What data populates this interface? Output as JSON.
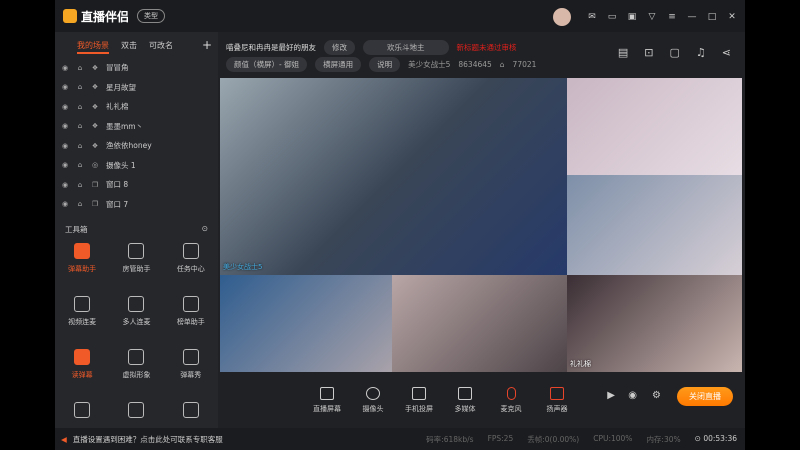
{
  "app": {
    "title": "直播伴侣",
    "type_btn": "类型"
  },
  "scenes": {
    "tabs": [
      "我的场景",
      "双击",
      "可改名"
    ],
    "sources": [
      {
        "type": "group",
        "name": "冒冒角"
      },
      {
        "type": "group",
        "name": "星月故望"
      },
      {
        "type": "group",
        "name": "礼礼棉"
      },
      {
        "type": "group",
        "name": "墨墨mm丶"
      },
      {
        "type": "group",
        "name": "渔依依honey"
      },
      {
        "type": "camera",
        "name": "摄像头 1"
      },
      {
        "type": "window",
        "name": "窗口 8"
      },
      {
        "type": "window",
        "name": "窗口 7"
      }
    ]
  },
  "toolbox": {
    "title": "工具箱",
    "items": [
      {
        "label": "弹幕助手",
        "active": true
      },
      {
        "label": "房管助手"
      },
      {
        "label": "任务中心"
      },
      {
        "label": "视频连麦"
      },
      {
        "label": "多人连麦"
      },
      {
        "label": "榜单助手"
      },
      {
        "label": "读弹幕",
        "active": true
      },
      {
        "label": "虚拟形象"
      },
      {
        "label": "弹幕秀"
      },
      {
        "label": ""
      },
      {
        "label": ""
      },
      {
        "label": ""
      }
    ]
  },
  "room": {
    "title": "喵叠尼和冉冉是最好的朋友",
    "edit": "修改",
    "category": "欢乐斗地主",
    "warning": "新标题未通过审核",
    "mode": "颜值（横屏）- 御姐",
    "layout": "横屏通用",
    "explain": "说明",
    "anchor": "美少女战士5",
    "room_id": "8634645",
    "heat": "77021"
  },
  "video": {
    "main_label": "美少女战士5",
    "labels": [
      "",
      "",
      "",
      "",
      "礼礼棉"
    ]
  },
  "controls": [
    "直播屏幕",
    "摄像头",
    "手机投屏",
    "多媒体",
    "麦克风",
    "扬声器"
  ],
  "live_button": "关闭直播",
  "status": {
    "notice": "直播设置遇到困难？点击此处可联系专职客服",
    "bitrate": "码率:618kb/s",
    "fps": "FPS:25",
    "drop": "丢帧:0(0.00%)",
    "cpu": "CPU:100%",
    "mem": "内存:30%",
    "time": "00:53:36"
  }
}
